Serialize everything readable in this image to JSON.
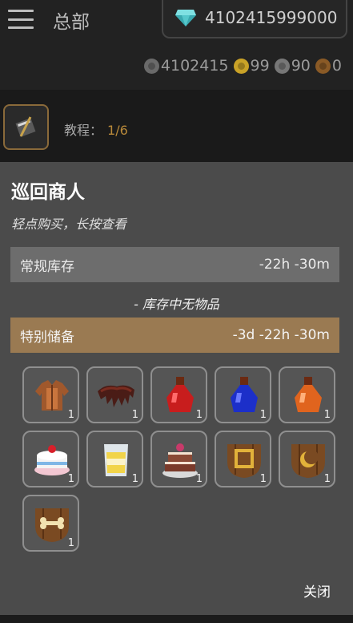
{
  "header": {
    "menu_icon": "hamburger-menu-icon",
    "title": "总部",
    "gem": {
      "icon": "diamond-icon",
      "value": "4102415999000",
      "color": "#5fc3c6"
    },
    "currencies": [
      {
        "icon": "crown-coin-icon",
        "value": "4102415"
      },
      {
        "icon": "gold-coin-icon",
        "value": "99"
      },
      {
        "icon": "silver-coin-icon",
        "value": "90"
      },
      {
        "icon": "copper-coin-icon",
        "value": "0"
      }
    ]
  },
  "tutorial": {
    "icon": "quest-scroll-icon",
    "label": "教程：",
    "progress": "1/6"
  },
  "merchant": {
    "title": "巡回商人",
    "subtitle": "轻点购买，长按查看",
    "regular": {
      "label": "常规库存",
      "timer": "-22h -30m"
    },
    "empty_text": "- 库存中无物品",
    "special": {
      "label": "特别储备",
      "timer": "-3d -22h -30m",
      "color": "#9a7a52"
    },
    "items": [
      {
        "icon": "leather-armor-icon",
        "qty": "1"
      },
      {
        "icon": "fur-pelt-icon",
        "qty": "1"
      },
      {
        "icon": "red-potion-icon",
        "qty": "1"
      },
      {
        "icon": "blue-potion-icon",
        "qty": "1"
      },
      {
        "icon": "orange-potion-icon",
        "qty": "1"
      },
      {
        "icon": "strawberry-cake-icon",
        "qty": "1"
      },
      {
        "icon": "glass-of-milk-icon",
        "qty": "1"
      },
      {
        "icon": "layer-cake-icon",
        "qty": "1"
      },
      {
        "icon": "square-emblem-chest-icon",
        "qty": "1"
      },
      {
        "icon": "moon-emblem-chest-icon",
        "qty": "1"
      },
      {
        "icon": "bone-emblem-chest-icon",
        "qty": "1"
      }
    ],
    "close_label": "关闭"
  }
}
